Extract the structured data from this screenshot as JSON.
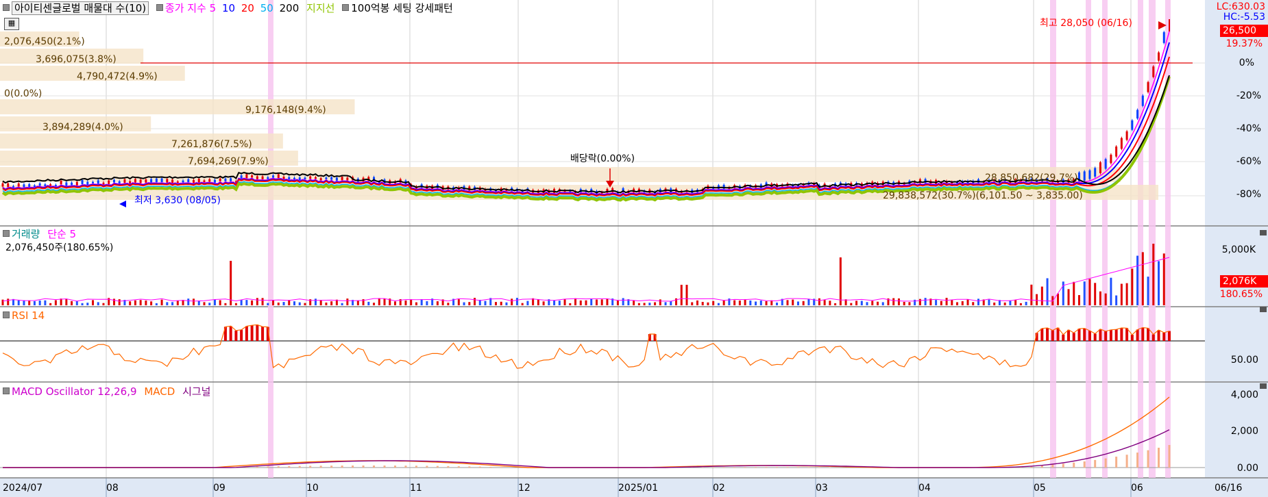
{
  "toolbar": {
    "stock_title": "아이티센글로벌 매물대 수(10)",
    "close_index_label": "종가 지수",
    "ma_periods": [
      "5",
      "10",
      "20",
      "50",
      "200"
    ],
    "support_label": "지지선",
    "pattern_label": "100억봉 세팅 강세패턴",
    "colors": {
      "ma5": "#ff00ff",
      "ma10": "#0000ff",
      "ma20": "#ff0000",
      "ma50": "#00b0f0",
      "ma200": "#000000",
      "support": "#8fc400"
    }
  },
  "price_panel": {
    "lc_label": "LC:630.03",
    "hc_label": "HC:-5.53",
    "current_price": "26,500",
    "current_change": "19.37%",
    "high_annotation": "최고 28,050 (06/16)",
    "low_annotation": "최저 3,630 (08/05)",
    "dividend_annotation": "배당락(0.00%)",
    "axis_ticks": [
      "0%",
      "-20%",
      "-40%",
      "-60%",
      "-80%"
    ],
    "volume_profile": [
      {
        "label": "2,076,450(2.1%)",
        "pct": 2.1
      },
      {
        "label": "3,696,075(3.8%)",
        "pct": 3.8
      },
      {
        "label": "4,790,472(4.9%)",
        "pct": 4.9
      },
      {
        "label": "0(0.0%)",
        "pct": 0
      },
      {
        "label": "9,176,148(9.4%)",
        "pct": 9.4
      },
      {
        "label": "3,894,289(4.0%)",
        "pct": 4.0
      },
      {
        "label": "7,261,876(7.5%)",
        "pct": 7.5
      },
      {
        "label": "7,694,269(7.9%)",
        "pct": 7.9
      },
      {
        "label": "28,850,682(29.7%)",
        "pct": 29.7
      },
      {
        "label": "29,838,572(30.7%)(6,101.50 ~ 3,835.00)",
        "pct": 30.7
      }
    ]
  },
  "volume_panel": {
    "title": "거래량",
    "ma_label": "단순 5",
    "summary": "2,076,450주(180.65%)",
    "axis_ticks": [
      "5,000K"
    ],
    "current_value": "2,076K",
    "current_pct": "180.65%"
  },
  "rsi_panel": {
    "title": "RSI 14",
    "axis_ticks": [
      "50.00"
    ]
  },
  "macd_panel": {
    "title": "MACD Oscillator 12,26,9",
    "macd_label": "MACD",
    "signal_label": "시그널",
    "axis_ticks": [
      "4,000",
      "2,000",
      "0.00"
    ]
  },
  "x_axis": {
    "ticks": [
      "2024/07",
      "08",
      "09",
      "10",
      "11",
      "12",
      "2025/01",
      "02",
      "03",
      "04",
      "05",
      "06",
      "06/16"
    ]
  }
}
